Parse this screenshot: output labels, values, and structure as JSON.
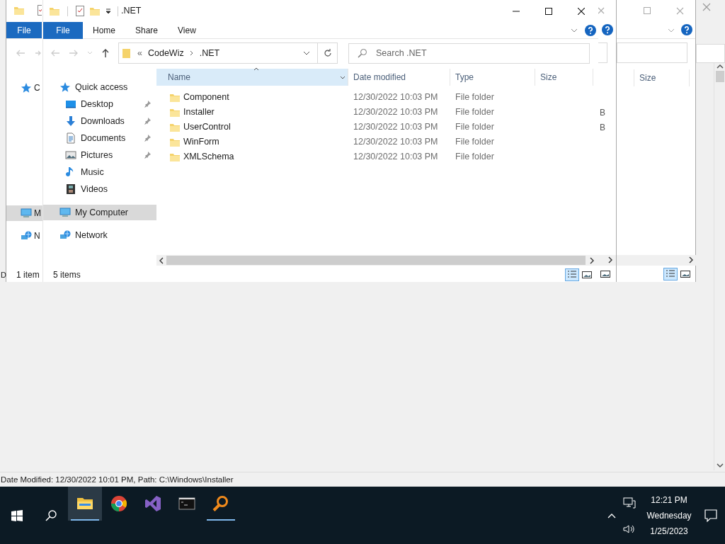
{
  "background_window": {
    "status_bar": "Date Modified: 12/30/2022 10:01 PM, Path: C:\\Windows\\Installer"
  },
  "left_window": {
    "ribbon_tab": "File",
    "nav_items": [
      {
        "label": "C",
        "kind": "star",
        "selected": false
      },
      {
        "label": "M",
        "kind": "computer",
        "selected": true
      },
      {
        "label": "N",
        "kind": "network",
        "selected": false
      }
    ],
    "status": "1 item",
    "behind_status": "D"
  },
  "main_window": {
    "title": ".NET",
    "ribbon_tabs": [
      {
        "label": "File",
        "selected": true
      },
      {
        "label": "Home",
        "selected": false
      },
      {
        "label": "Share",
        "selected": false
      },
      {
        "label": "View",
        "selected": false
      }
    ],
    "breadcrumb": [
      "«",
      "CodeWiz",
      ".NET"
    ],
    "search": {
      "placeholder": "Search .NET"
    },
    "nav_items": [
      {
        "label": "Quick access",
        "kind": "star",
        "pinned": false,
        "selected": false,
        "children": [
          {
            "label": "Desktop",
            "kind": "desktop",
            "pinned": true,
            "selected": false
          },
          {
            "label": "Downloads",
            "kind": "download",
            "pinned": true,
            "selected": false
          },
          {
            "label": "Documents",
            "kind": "document",
            "pinned": true,
            "selected": false
          },
          {
            "label": "Pictures",
            "kind": "pictures",
            "pinned": true,
            "selected": false
          },
          {
            "label": "Music",
            "kind": "music",
            "pinned": false,
            "selected": false
          },
          {
            "label": "Videos",
            "kind": "video",
            "pinned": false,
            "selected": false
          }
        ]
      },
      {
        "label": "My Computer",
        "kind": "computer",
        "pinned": false,
        "selected": true
      },
      {
        "label": "Network",
        "kind": "network",
        "pinned": false,
        "selected": false
      }
    ],
    "columns": [
      {
        "label": "Name",
        "selected": true
      },
      {
        "label": "Date modified",
        "selected": false
      },
      {
        "label": "Type",
        "selected": false
      },
      {
        "label": "Size",
        "selected": false
      }
    ],
    "rows": [
      {
        "name": "Component",
        "date": "12/30/2022 10:03 PM",
        "type": "File folder"
      },
      {
        "name": "Installer",
        "date": "12/30/2022 10:03 PM",
        "type": "File folder"
      },
      {
        "name": "UserControl",
        "date": "12/30/2022 10:03 PM",
        "type": "File folder"
      },
      {
        "name": "WinForm",
        "date": "12/30/2022 10:03 PM",
        "type": "File folder"
      },
      {
        "name": "XMLSchema",
        "date": "12/30/2022 10:03 PM",
        "type": "File folder"
      }
    ],
    "status": "5 items"
  },
  "middle_window": {
    "size_cells": [
      "B",
      "B"
    ]
  },
  "right_window": {
    "columns": [
      "Size"
    ]
  },
  "taskbar": {
    "apps": [
      {
        "kind": "explorer",
        "selected": true
      },
      {
        "kind": "chrome",
        "selected": false
      },
      {
        "kind": "vs",
        "selected": false
      },
      {
        "kind": "terminal",
        "selected": false
      },
      {
        "kind": "magnifier",
        "selected": true
      }
    ],
    "time": "12:21 PM",
    "day": "Wednesday",
    "date": "1/25/2023"
  }
}
